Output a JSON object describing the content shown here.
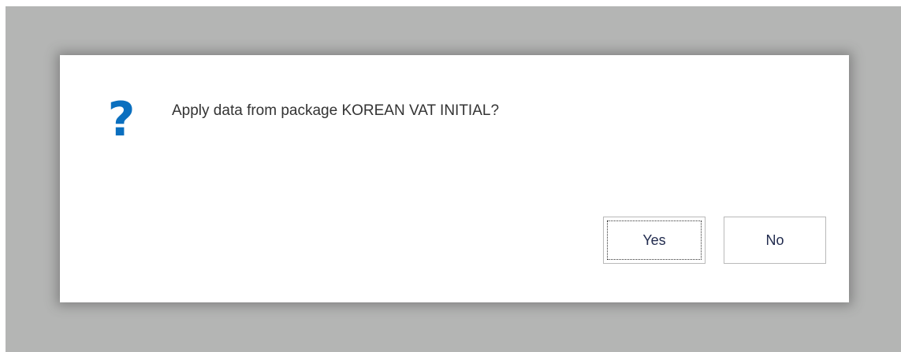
{
  "dialog": {
    "icon": "question-mark-icon",
    "icon_glyph": "?",
    "icon_color": "#0a6fbf",
    "message": "Apply data from package KOREAN VAT INITIAL?",
    "buttons": {
      "yes_label": "Yes",
      "no_label": "No"
    },
    "focused_button": "yes"
  },
  "colors": {
    "overlay": "#b4b5b4",
    "dialog_background": "#ffffff",
    "button_border": "#b9b9b9",
    "button_text": "#212b4e"
  }
}
